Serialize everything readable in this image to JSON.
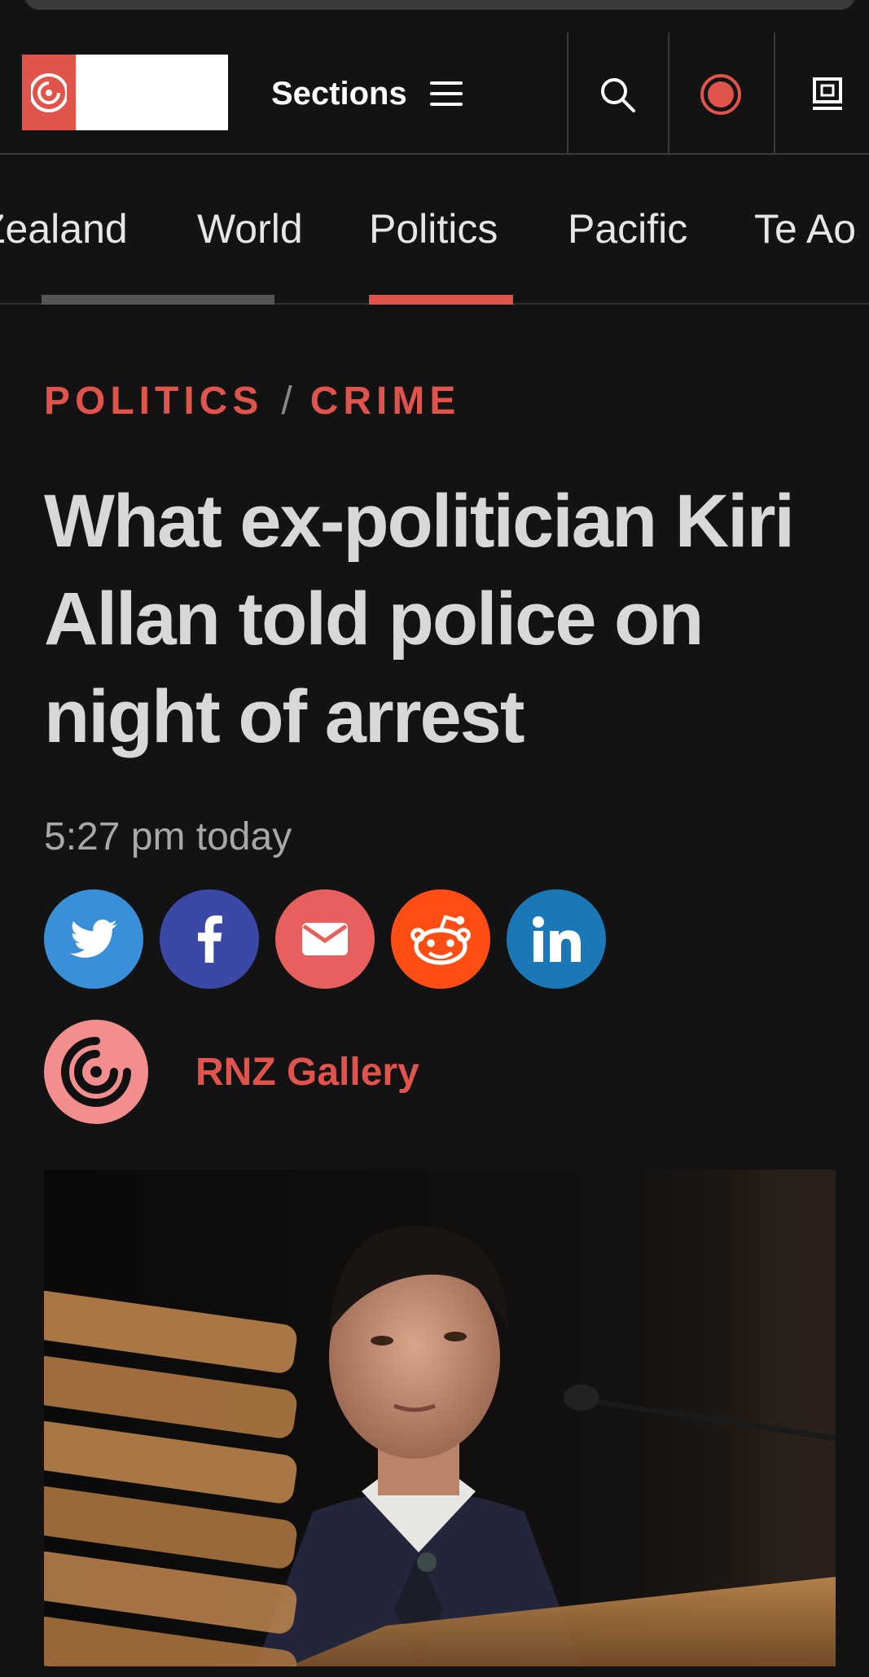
{
  "header": {
    "sections_label": "Sections",
    "icons": {
      "search": "search-icon",
      "live": "live-radio-icon",
      "screen": "screen-icon",
      "menu": "hamburger-menu-icon"
    }
  },
  "nav": {
    "tabs": [
      {
        "label": "Zealand"
      },
      {
        "label": "World"
      },
      {
        "label": "Politics"
      },
      {
        "label": "Pacific"
      },
      {
        "label": "Te Ao"
      }
    ],
    "active_tab": "Politics"
  },
  "article": {
    "category_1": "POLITICS",
    "separator": "/",
    "category_2": "CRIME",
    "headline": "What ex-politician Kiri Allan told police on night of arrest",
    "timestamp": "5:27 pm today",
    "author": "RNZ Gallery",
    "share": [
      {
        "name": "twitter",
        "icon": "twitter-icon",
        "color": "#3a8fd9"
      },
      {
        "name": "facebook",
        "icon": "facebook-icon",
        "color": "#3b48a6"
      },
      {
        "name": "email",
        "icon": "email-icon",
        "color": "#e8605e"
      },
      {
        "name": "reddit",
        "icon": "reddit-icon",
        "color": "#ff4d14"
      },
      {
        "name": "linkedin",
        "icon": "linkedin-icon",
        "color": "#1978b5"
      }
    ]
  },
  "colors": {
    "accent": "#e1544b",
    "background": "#131313",
    "headline": "#d6d9d6"
  }
}
